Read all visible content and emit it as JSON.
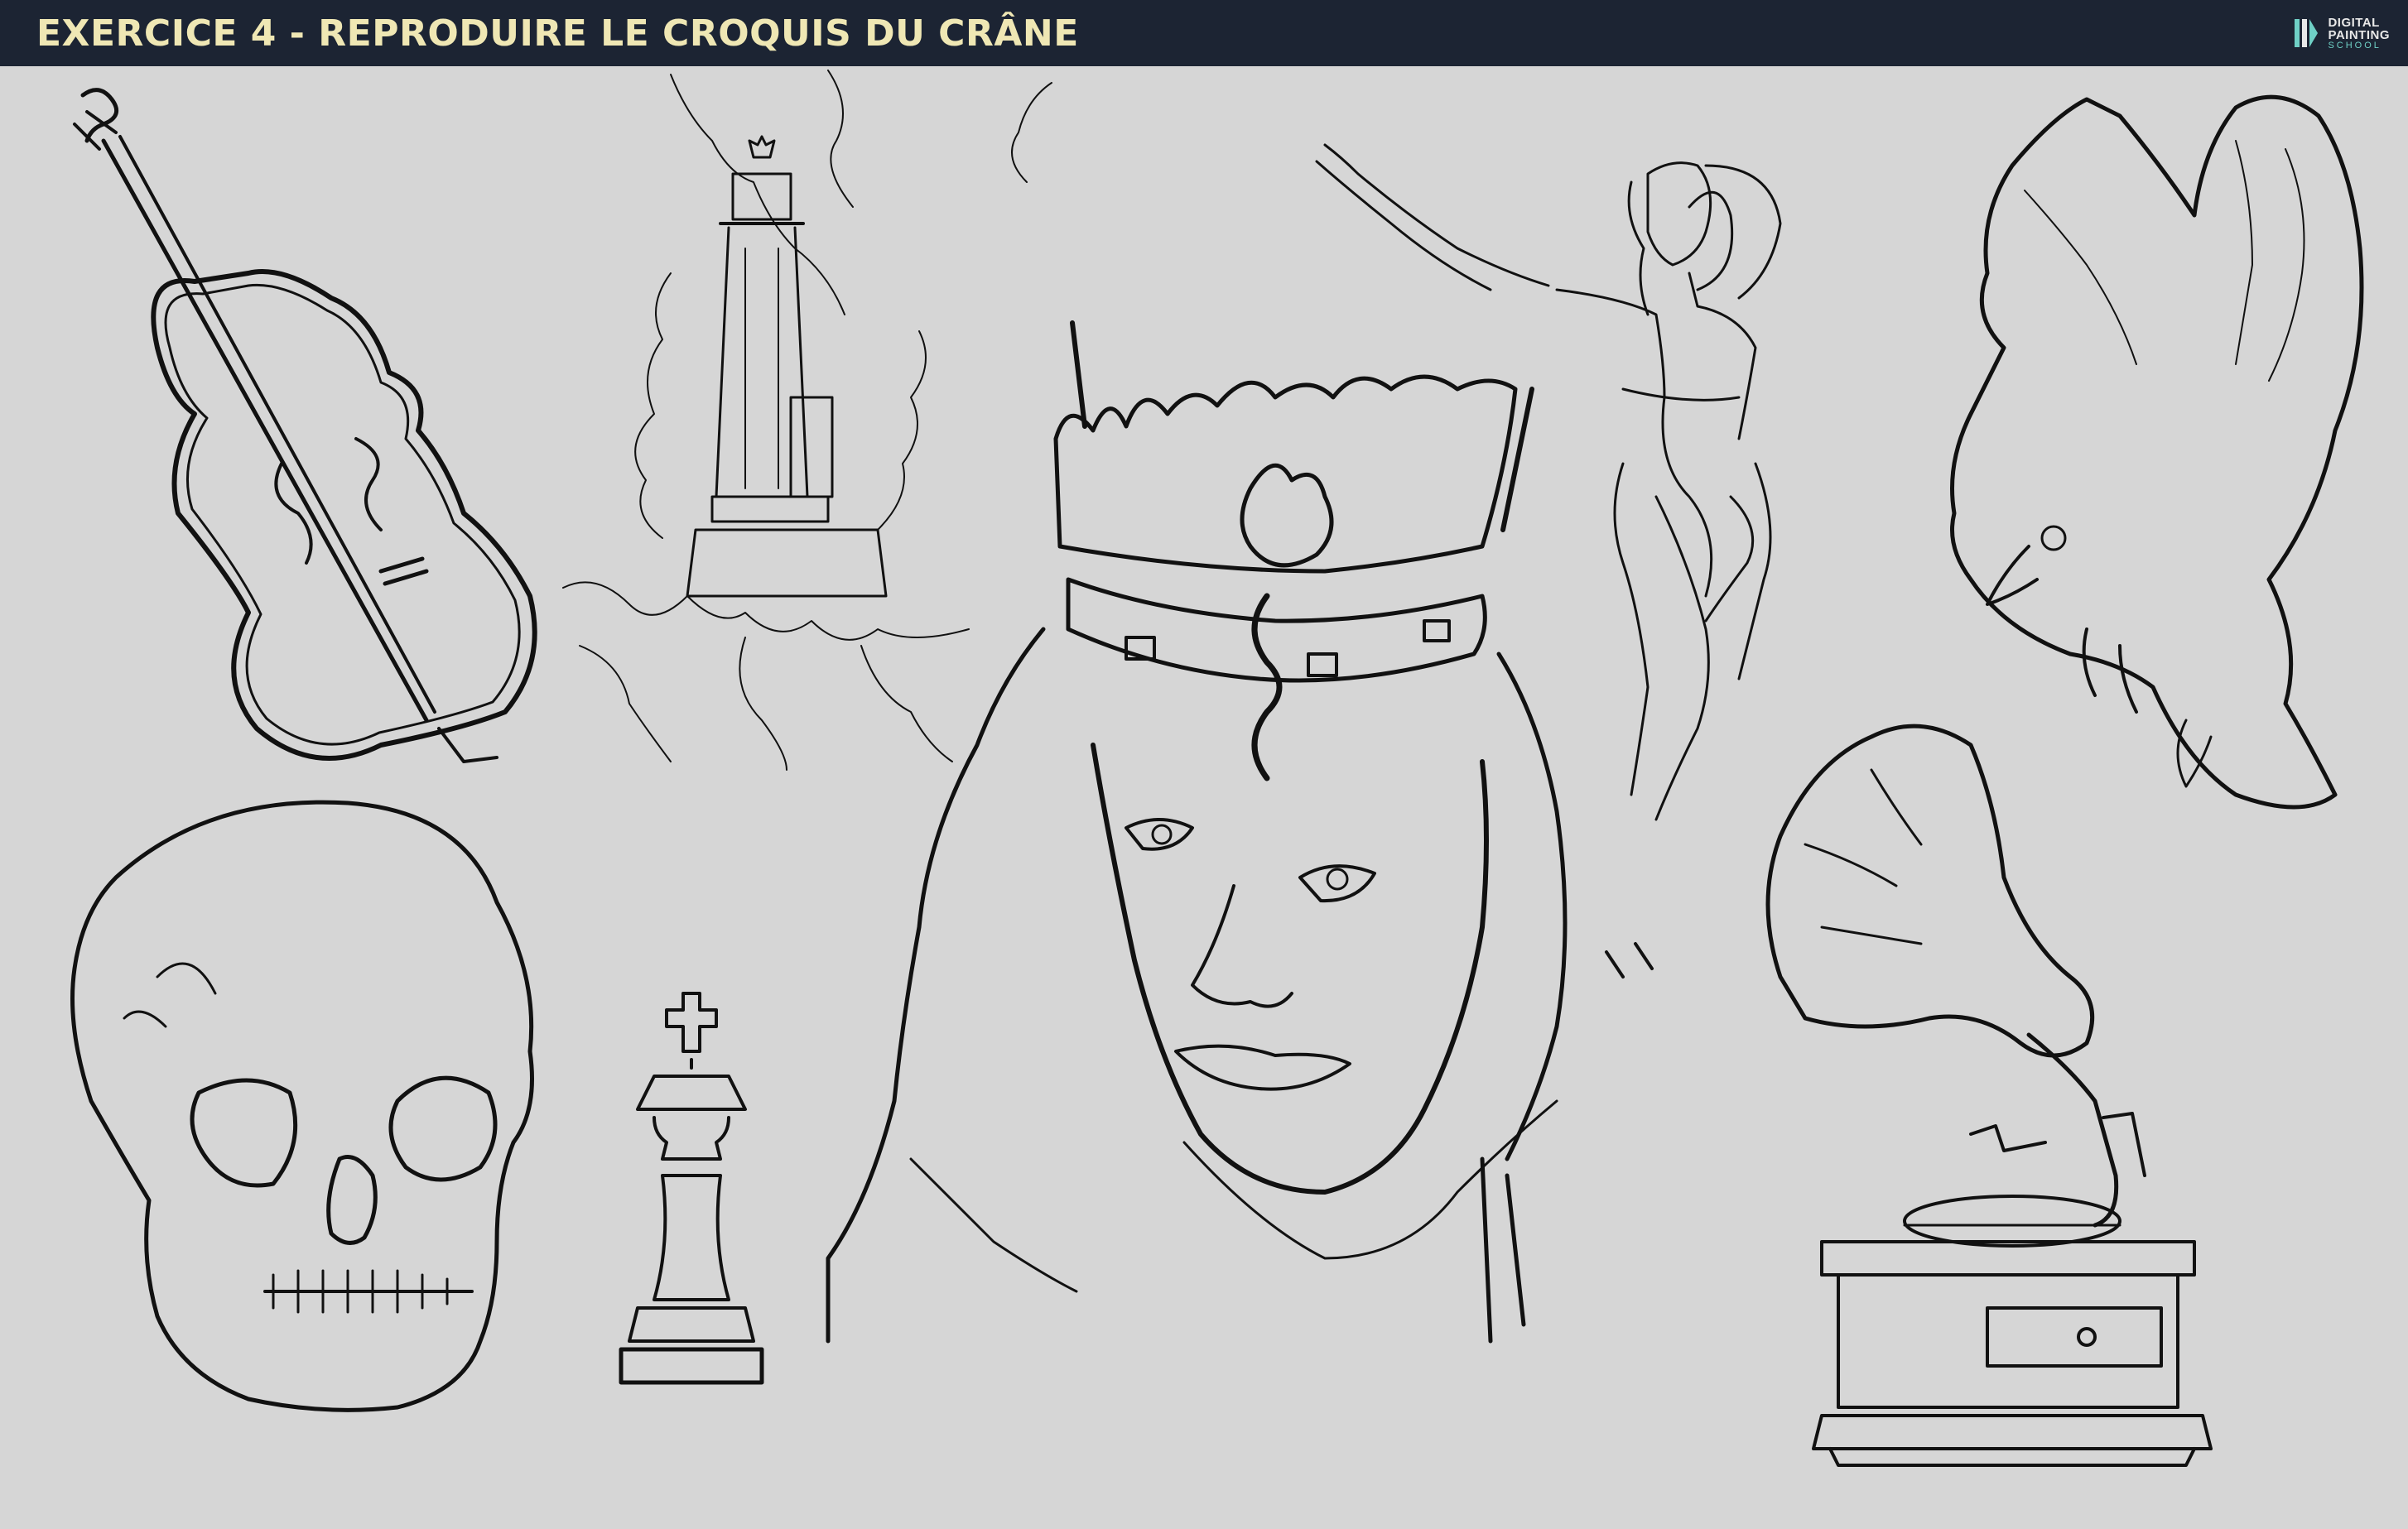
{
  "header": {
    "title": "EXERCICE 4 - REPRODUIRE LE CROQUIS DU CRÂNE",
    "brand": {
      "line1": "DIGITAL",
      "line2": "PAINTING",
      "line3": "SCHOOL",
      "icon": "digital-painting-school-logo"
    }
  },
  "colors": {
    "header_bg": "#1c2433",
    "title": "#efe7b4",
    "canvas_bg": "#d6d6d6",
    "ink": "#111111",
    "brand_accent": "#6fd0c6"
  },
  "sketches": [
    {
      "id": "cello",
      "subject": "violoncelle"
    },
    {
      "id": "lighthouse",
      "subject": "phare"
    },
    {
      "id": "dancer",
      "subject": "danseuse"
    },
    {
      "id": "bird",
      "subject": "oiseau"
    },
    {
      "id": "crowned-woman",
      "subject": "femme couronnée"
    },
    {
      "id": "skull",
      "subject": "crâne"
    },
    {
      "id": "chess-king",
      "subject": "roi d'échecs"
    },
    {
      "id": "gramophone",
      "subject": "gramophone"
    }
  ]
}
